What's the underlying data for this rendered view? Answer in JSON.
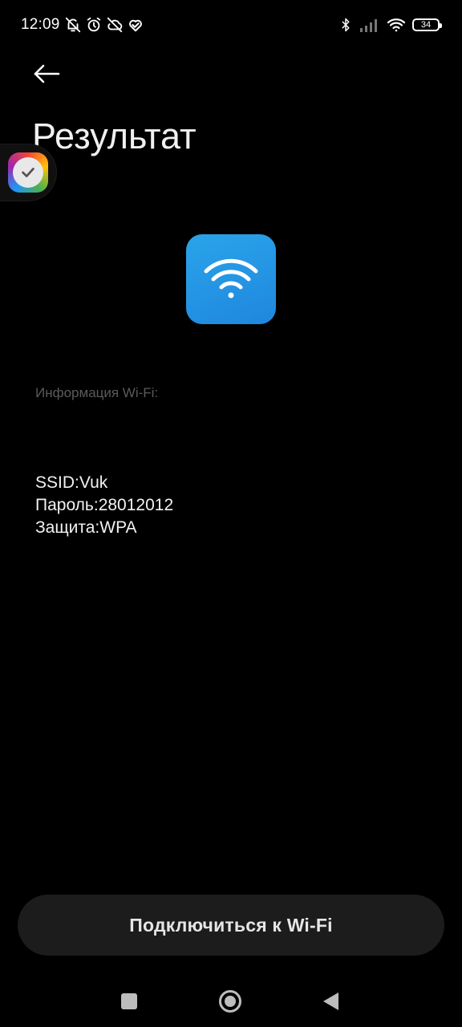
{
  "status_bar": {
    "time": "12:09",
    "left_icons": [
      "bell-off-icon",
      "alarm-icon",
      "cloud-off-icon",
      "heart-icon"
    ],
    "right_icons": [
      "bluetooth-icon",
      "signal-icon",
      "wifi-icon"
    ],
    "battery": "34"
  },
  "header": {
    "back_icon": "arrow-left-icon",
    "title": "Результат"
  },
  "wifi_tile": {
    "icon": "wifi-icon",
    "color": "#2196e6"
  },
  "info": {
    "label": "Информация Wi-Fi:",
    "ssid": "SSID:Vuk",
    "password": "Пароль:28012012",
    "security": "Защита:WPA"
  },
  "actions": {
    "connect_label": "Подключиться к Wi-Fi"
  },
  "nav_bar": {
    "items": [
      "recents-icon",
      "home-icon",
      "back-triangle-icon"
    ]
  }
}
